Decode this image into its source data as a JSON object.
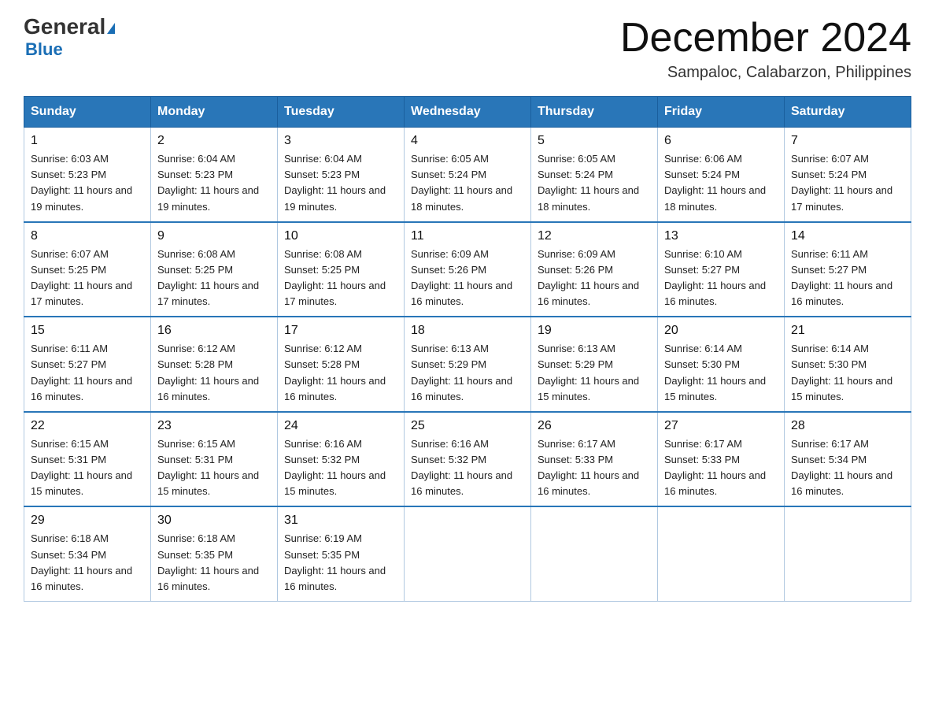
{
  "header": {
    "logo_general": "General",
    "logo_blue": "Blue",
    "month_title": "December 2024",
    "subtitle": "Sampaloc, Calabarzon, Philippines"
  },
  "days_of_week": [
    "Sunday",
    "Monday",
    "Tuesday",
    "Wednesday",
    "Thursday",
    "Friday",
    "Saturday"
  ],
  "weeks": [
    [
      {
        "day": "1",
        "sunrise": "6:03 AM",
        "sunset": "5:23 PM",
        "daylight": "11 hours and 19 minutes."
      },
      {
        "day": "2",
        "sunrise": "6:04 AM",
        "sunset": "5:23 PM",
        "daylight": "11 hours and 19 minutes."
      },
      {
        "day": "3",
        "sunrise": "6:04 AM",
        "sunset": "5:23 PM",
        "daylight": "11 hours and 19 minutes."
      },
      {
        "day": "4",
        "sunrise": "6:05 AM",
        "sunset": "5:24 PM",
        "daylight": "11 hours and 18 minutes."
      },
      {
        "day": "5",
        "sunrise": "6:05 AM",
        "sunset": "5:24 PM",
        "daylight": "11 hours and 18 minutes."
      },
      {
        "day": "6",
        "sunrise": "6:06 AM",
        "sunset": "5:24 PM",
        "daylight": "11 hours and 18 minutes."
      },
      {
        "day": "7",
        "sunrise": "6:07 AM",
        "sunset": "5:24 PM",
        "daylight": "11 hours and 17 minutes."
      }
    ],
    [
      {
        "day": "8",
        "sunrise": "6:07 AM",
        "sunset": "5:25 PM",
        "daylight": "11 hours and 17 minutes."
      },
      {
        "day": "9",
        "sunrise": "6:08 AM",
        "sunset": "5:25 PM",
        "daylight": "11 hours and 17 minutes."
      },
      {
        "day": "10",
        "sunrise": "6:08 AM",
        "sunset": "5:25 PM",
        "daylight": "11 hours and 17 minutes."
      },
      {
        "day": "11",
        "sunrise": "6:09 AM",
        "sunset": "5:26 PM",
        "daylight": "11 hours and 16 minutes."
      },
      {
        "day": "12",
        "sunrise": "6:09 AM",
        "sunset": "5:26 PM",
        "daylight": "11 hours and 16 minutes."
      },
      {
        "day": "13",
        "sunrise": "6:10 AM",
        "sunset": "5:27 PM",
        "daylight": "11 hours and 16 minutes."
      },
      {
        "day": "14",
        "sunrise": "6:11 AM",
        "sunset": "5:27 PM",
        "daylight": "11 hours and 16 minutes."
      }
    ],
    [
      {
        "day": "15",
        "sunrise": "6:11 AM",
        "sunset": "5:27 PM",
        "daylight": "11 hours and 16 minutes."
      },
      {
        "day": "16",
        "sunrise": "6:12 AM",
        "sunset": "5:28 PM",
        "daylight": "11 hours and 16 minutes."
      },
      {
        "day": "17",
        "sunrise": "6:12 AM",
        "sunset": "5:28 PM",
        "daylight": "11 hours and 16 minutes."
      },
      {
        "day": "18",
        "sunrise": "6:13 AM",
        "sunset": "5:29 PM",
        "daylight": "11 hours and 16 minutes."
      },
      {
        "day": "19",
        "sunrise": "6:13 AM",
        "sunset": "5:29 PM",
        "daylight": "11 hours and 15 minutes."
      },
      {
        "day": "20",
        "sunrise": "6:14 AM",
        "sunset": "5:30 PM",
        "daylight": "11 hours and 15 minutes."
      },
      {
        "day": "21",
        "sunrise": "6:14 AM",
        "sunset": "5:30 PM",
        "daylight": "11 hours and 15 minutes."
      }
    ],
    [
      {
        "day": "22",
        "sunrise": "6:15 AM",
        "sunset": "5:31 PM",
        "daylight": "11 hours and 15 minutes."
      },
      {
        "day": "23",
        "sunrise": "6:15 AM",
        "sunset": "5:31 PM",
        "daylight": "11 hours and 15 minutes."
      },
      {
        "day": "24",
        "sunrise": "6:16 AM",
        "sunset": "5:32 PM",
        "daylight": "11 hours and 15 minutes."
      },
      {
        "day": "25",
        "sunrise": "6:16 AM",
        "sunset": "5:32 PM",
        "daylight": "11 hours and 16 minutes."
      },
      {
        "day": "26",
        "sunrise": "6:17 AM",
        "sunset": "5:33 PM",
        "daylight": "11 hours and 16 minutes."
      },
      {
        "day": "27",
        "sunrise": "6:17 AM",
        "sunset": "5:33 PM",
        "daylight": "11 hours and 16 minutes."
      },
      {
        "day": "28",
        "sunrise": "6:17 AM",
        "sunset": "5:34 PM",
        "daylight": "11 hours and 16 minutes."
      }
    ],
    [
      {
        "day": "29",
        "sunrise": "6:18 AM",
        "sunset": "5:34 PM",
        "daylight": "11 hours and 16 minutes."
      },
      {
        "day": "30",
        "sunrise": "6:18 AM",
        "sunset": "5:35 PM",
        "daylight": "11 hours and 16 minutes."
      },
      {
        "day": "31",
        "sunrise": "6:19 AM",
        "sunset": "5:35 PM",
        "daylight": "11 hours and 16 minutes."
      },
      null,
      null,
      null,
      null
    ]
  ]
}
